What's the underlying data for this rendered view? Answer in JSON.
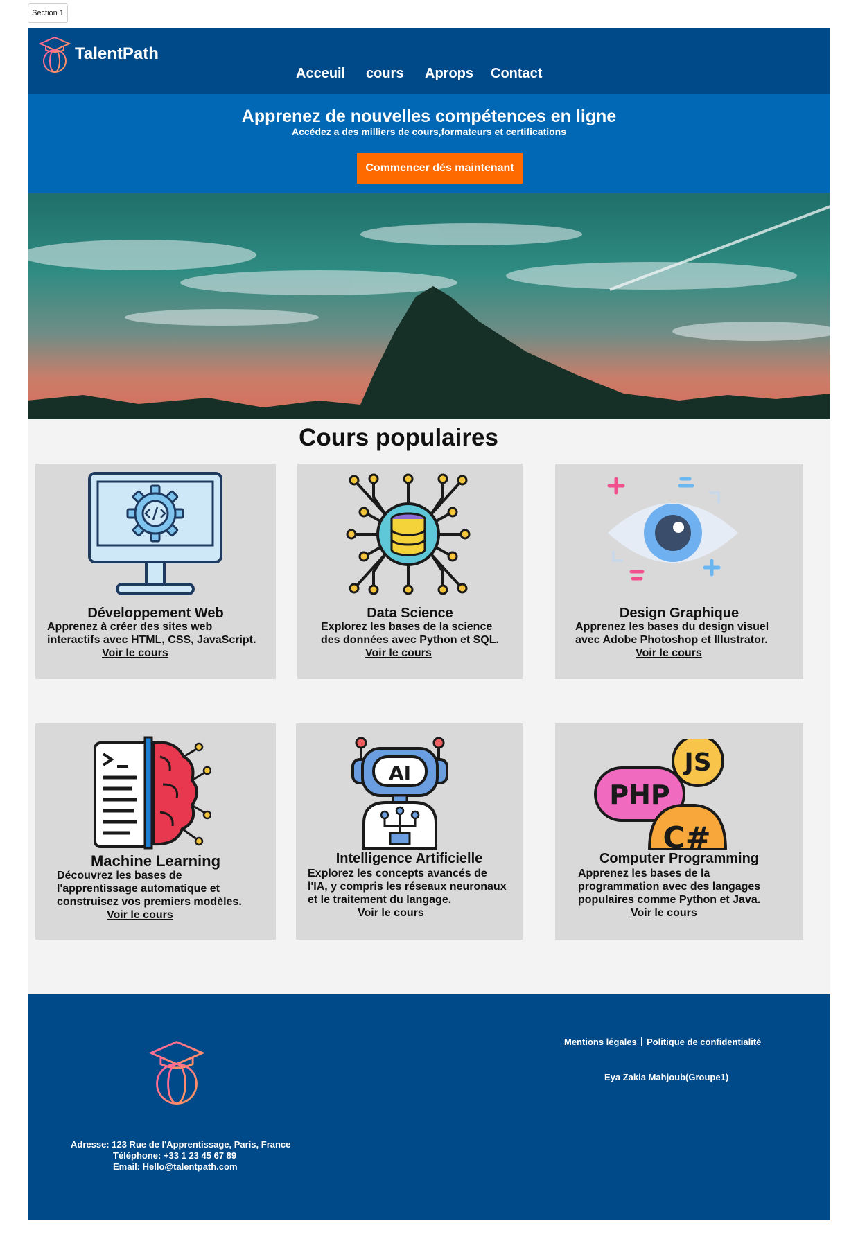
{
  "section_tag": "Section 1",
  "header": {
    "brand": "TalentPath",
    "nav": [
      "Acceuil",
      "cours",
      "Aprops",
      "Contact"
    ]
  },
  "hero": {
    "title": "Apprenez de nouvelles compétences en ligne",
    "subtitle": "Accédez a des milliers de cours,formateurs et certifications",
    "cta": "Commencer dés maintenant"
  },
  "courses": {
    "heading": "Cours populaires",
    "link_label": "Voir le cours",
    "items": [
      {
        "title": "Développement Web",
        "description": "Apprenez à créer des sites web\ninteractifs avec HTML, CSS, JavaScript.",
        "icon": "computer-code-icon"
      },
      {
        "title": "Data Science",
        "description": "Explorez les bases de la science\ndes données avec Python et SQL.",
        "icon": "database-chip-icon"
      },
      {
        "title": "Design Graphique",
        "description": "Apprenez les bases du design visuel\navec Adobe Photoshop et Illustrator.",
        "icon": "eye-icon"
      },
      {
        "title": "Machine Learning",
        "description": "Découvrez les bases de\nl'apprentissage automatique et\nconstruisez vos premiers modèles.",
        "icon": "brain-code-icon"
      },
      {
        "title": "Intelligence Artificielle",
        "description": "Explorez les concepts avancés de\nl'IA, y compris les réseaux neuronaux\net le traitement du langage.",
        "icon": "ai-robot-icon"
      },
      {
        "title": "Computer Programming",
        "description": "Apprenez les bases de la\nprogrammation avec des langages\npopulaires comme Python et Java.",
        "icon": "programming-languages-icon"
      }
    ]
  },
  "footer": {
    "legal_link": "Mentions légales",
    "separator": "|",
    "privacy_link": "Politique de confidentialité",
    "author": "Eya Zakia Mahjoub(Groupe1)",
    "address": "Adresse: 123 Rue de l'Apprentissage, Paris, France",
    "phone": "Téléphone: +33 1 23 45 67 89",
    "email": "Email: Hello@talentpath.com"
  },
  "colors": {
    "header_bg": "#004a8a",
    "hero_bg": "#0068b4",
    "cta_bg": "#ff6a00",
    "card_bg": "#d9d9d9",
    "page_bg": "#f3f3f3"
  }
}
